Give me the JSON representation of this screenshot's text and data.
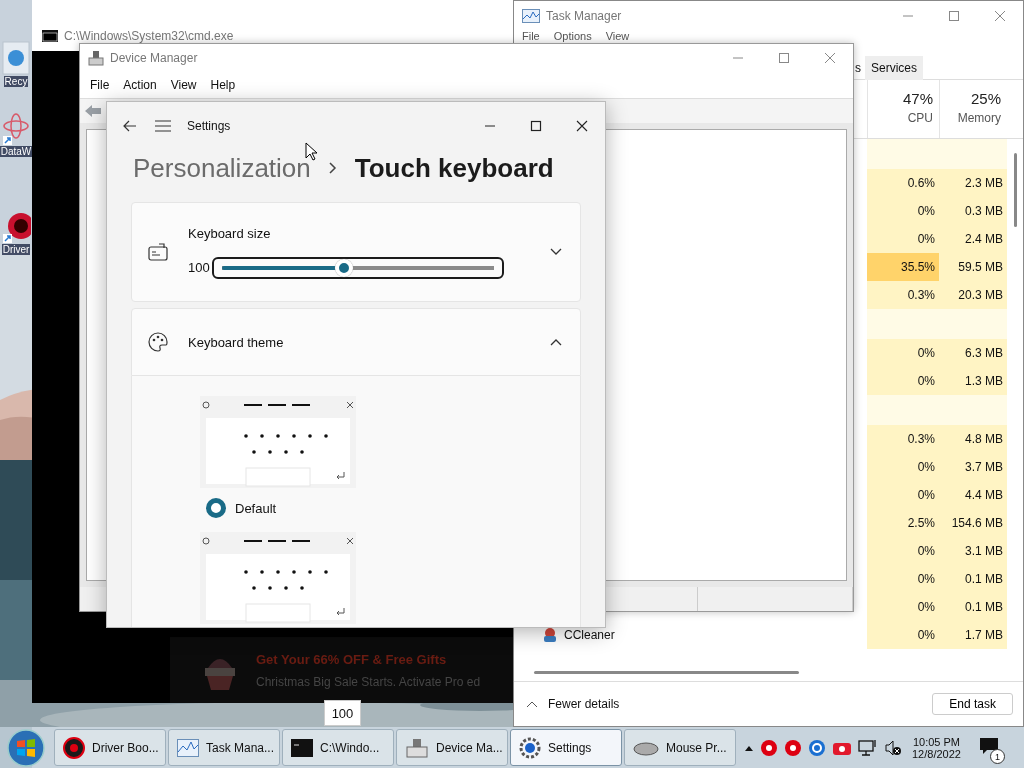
{
  "desktop": {
    "icons": [
      {
        "label": "Recy"
      },
      {
        "label": "DataW"
      },
      {
        "label": "Driver"
      }
    ]
  },
  "cmd_window": {
    "title": "C:\\Windows\\System32\\cmd.exe",
    "ad": {
      "headline": "Get Your 66% OFF & Free Gifts",
      "text": "Christmas Big Sale Starts. Activate Pro ed"
    }
  },
  "device_manager": {
    "title": "Device Manager",
    "menu": [
      "File",
      "Action",
      "View",
      "Help"
    ]
  },
  "task_manager": {
    "title": "Task Manager",
    "menu": [
      "File",
      "Options",
      "View"
    ],
    "tabs": [
      "s",
      "Services"
    ],
    "columns": [
      {
        "percent": "47%",
        "label": "CPU"
      },
      {
        "percent": "25%",
        "label": "Memory"
      }
    ],
    "rows": [
      {
        "kind": "group"
      },
      {
        "kind": "process",
        "cpu": "0.6%",
        "memory": "2.3 MB",
        "highlighted": false
      },
      {
        "kind": "process",
        "cpu": "0%",
        "memory": "0.3 MB",
        "highlighted": false
      },
      {
        "kind": "process",
        "cpu": "0%",
        "memory": "2.4 MB",
        "highlighted": false
      },
      {
        "kind": "process",
        "cpu": "35.5%",
        "memory": "59.5 MB",
        "highlighted": true
      },
      {
        "kind": "process",
        "cpu": "0.3%",
        "memory": "20.3 MB",
        "highlighted": false
      },
      {
        "kind": "group"
      },
      {
        "kind": "process",
        "cpu": "0%",
        "memory": "6.3 MB",
        "highlighted": false
      },
      {
        "kind": "process",
        "cpu": "0%",
        "memory": "1.3 MB",
        "highlighted": false
      },
      {
        "kind": "group"
      },
      {
        "kind": "process",
        "cpu": "0.3%",
        "memory": "4.8 MB",
        "highlighted": false
      },
      {
        "kind": "process",
        "cpu": "0%",
        "memory": "3.7 MB",
        "highlighted": false
      },
      {
        "kind": "process",
        "cpu": "0%",
        "memory": "4.4 MB",
        "highlighted": false
      },
      {
        "kind": "process",
        "cpu": "2.5%",
        "memory": "154.6 MB",
        "highlighted": false
      },
      {
        "kind": "process",
        "cpu": "0%",
        "memory": "3.1 MB",
        "highlighted": false
      },
      {
        "kind": "process",
        "cpu": "0%",
        "memory": "0.1 MB",
        "highlighted": false
      },
      {
        "kind": "process",
        "cpu": "0%",
        "memory": "0.1 MB",
        "highlighted": false
      },
      {
        "kind": "process",
        "name": "CCleaner",
        "cpu": "0%",
        "memory": "1.7 MB",
        "highlighted": false
      }
    ],
    "footer": {
      "toggle": "Fewer details",
      "button": "End task"
    }
  },
  "settings": {
    "title": "Settings",
    "breadcrumb": {
      "parent": "Personalization",
      "current": "Touch keyboard"
    },
    "cards": [
      {
        "kind": "slider",
        "label": "Keyboard size",
        "value": "100",
        "level": 0.45,
        "focused": true,
        "expanded": false
      },
      {
        "kind": "themes",
        "label": "Keyboard theme",
        "expanded": true,
        "themes": [
          {
            "kind": "option",
            "label": "Default",
            "selected": true
          },
          {
            "kind": "cut"
          }
        ]
      }
    ]
  },
  "tooltip": "100",
  "taskbar": {
    "items": [
      {
        "label": "Driver Boo...",
        "selected": false
      },
      {
        "label": "Task Mana...",
        "selected": false
      },
      {
        "label": "C:\\Windo...",
        "selected": false
      },
      {
        "label": "Device Ma...",
        "selected": false
      },
      {
        "label": "Settings",
        "selected": true
      },
      {
        "label": "Mouse Pr...",
        "selected": false
      }
    ],
    "time": "10:05 PM",
    "date": "12/8/2022",
    "notifications": "1"
  }
}
